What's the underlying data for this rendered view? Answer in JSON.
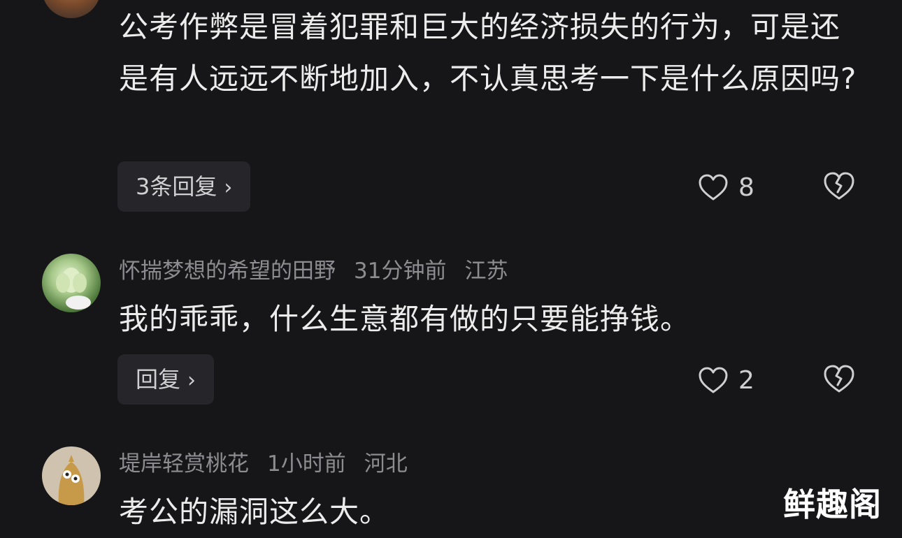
{
  "comments": [
    {
      "text": "公考作弊是冒着犯罪和巨大的经济损失的行为，可是还是有人远远不断地加入，不认真思考一下是什么原因吗?",
      "reply_label": "3条回复",
      "likes": "8"
    },
    {
      "username": "怀揣梦想的希望的田野",
      "time": "31分钟前",
      "location": "江苏",
      "text": "我的乖乖，什么生意都有做的只要能挣钱。",
      "reply_label": "回复",
      "likes": "2"
    },
    {
      "username": "堤岸轻赏桃花",
      "time": "1小时前",
      "location": "河北",
      "text": "考公的漏洞这么大。"
    }
  ],
  "watermark": "鲜趣阁",
  "colors": {
    "background": "#161618",
    "meta": "#8d8d91",
    "button_bg": "#26262a"
  },
  "icons": [
    "heart-outline-icon",
    "broken-heart-icon",
    "chevron-right-icon"
  ]
}
